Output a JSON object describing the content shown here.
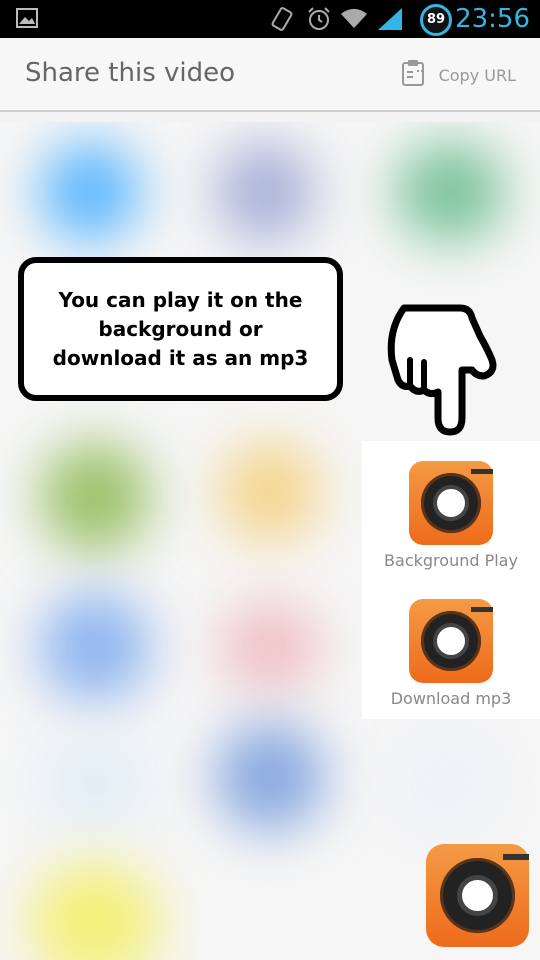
{
  "status_bar": {
    "time": "23:56",
    "battery": "89",
    "icons": [
      "gallery-icon",
      "rotate-icon",
      "alarm-icon",
      "wifi-icon",
      "signal-icon",
      "battery-icon"
    ],
    "accent": "#33b5e5"
  },
  "header": {
    "title": "Share this video",
    "copy_url_label": "Copy URL",
    "copy_url_icon": "clipboard-icon"
  },
  "tooltip": {
    "text": "You can play it on the background or download it as an mp3"
  },
  "options": [
    {
      "label": "Background Play",
      "icon": "camera-lens-icon"
    },
    {
      "label": "Download mp3",
      "icon": "camera-lens-icon"
    }
  ],
  "fab": {
    "icon": "camera-lens-icon"
  },
  "colors": {
    "brand_orange": "#ef7524",
    "tooltip_border": "#000000"
  }
}
